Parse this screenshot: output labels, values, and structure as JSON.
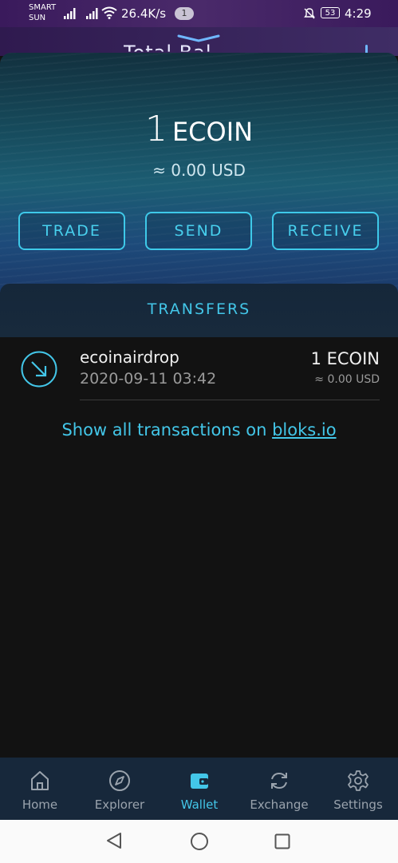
{
  "status_bar": {
    "carrier_line1": "SMART",
    "carrier_line2": "SUN",
    "speed": "26.4K/s",
    "notification_count": "1",
    "battery": "53",
    "time": "4:29"
  },
  "header": {
    "title": "Total Bal"
  },
  "balance": {
    "amount": "1",
    "symbol": "ECOIN",
    "usd": "≈ 0.00 USD"
  },
  "actions": {
    "trade": "TRADE",
    "send": "SEND",
    "receive": "RECEIVE"
  },
  "transfers": {
    "title": "TRANSFERS",
    "items": [
      {
        "name": "ecoinairdrop",
        "date": "2020-09-11 03:42",
        "amount": "1 ECOIN",
        "usd": "≈ 0.00 USD",
        "icon": "incoming-arrow-icon"
      }
    ],
    "show_all_prefix": "Show all transactions on ",
    "show_all_link": "bloks.io"
  },
  "bottom_nav": {
    "items": [
      {
        "label": "Home",
        "icon": "home-icon",
        "active": false
      },
      {
        "label": "Explorer",
        "icon": "compass-icon",
        "active": false
      },
      {
        "label": "Wallet",
        "icon": "wallet-icon",
        "active": true
      },
      {
        "label": "Exchange",
        "icon": "exchange-icon",
        "active": false
      },
      {
        "label": "Settings",
        "icon": "gear-icon",
        "active": false
      }
    ]
  },
  "colors": {
    "accent": "#43c6e8",
    "background": "#121212",
    "nav_background": "#17283b"
  }
}
